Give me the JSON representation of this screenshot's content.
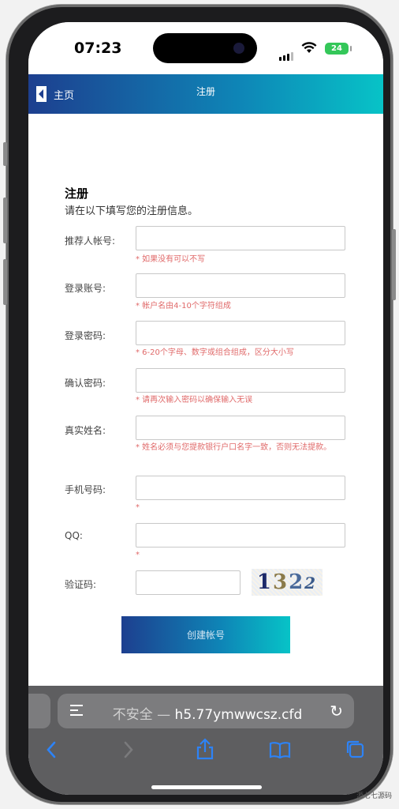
{
  "status": {
    "time": "07:23",
    "battery": "24"
  },
  "header": {
    "back_label": "主页",
    "title": "注册"
  },
  "form": {
    "title": "注册",
    "subtitle": "请在以下填写您的注册信息。",
    "fields": [
      {
        "label": "推荐人帐号:",
        "hint": "* 如果没有可以不写"
      },
      {
        "label": "登录账号:",
        "hint": "* 帐户名由4-10个字符组成"
      },
      {
        "label": "登录密码:",
        "hint": "* 6-20个字母、数字或组合组成，区分大小写"
      },
      {
        "label": "确认密码:",
        "hint": "* 请再次输入密码以确保输入无误"
      },
      {
        "label": "真实姓名:",
        "hint": "* 姓名必须与您提款银行户口名字一致，否则无法提款。"
      },
      {
        "label": "手机号码:",
        "hint": "*"
      },
      {
        "label": "QQ:",
        "hint": "*"
      },
      {
        "label": "验证码:"
      }
    ],
    "captcha": {
      "d1": "1",
      "d2": "3",
      "d3": "2",
      "d4": "2"
    },
    "submit_label": "创建帐号"
  },
  "browser": {
    "insecure": "不安全",
    "separator": " — ",
    "url": "h5.77ymwwcsz.cfd"
  },
  "watermark": "源七七源码"
}
